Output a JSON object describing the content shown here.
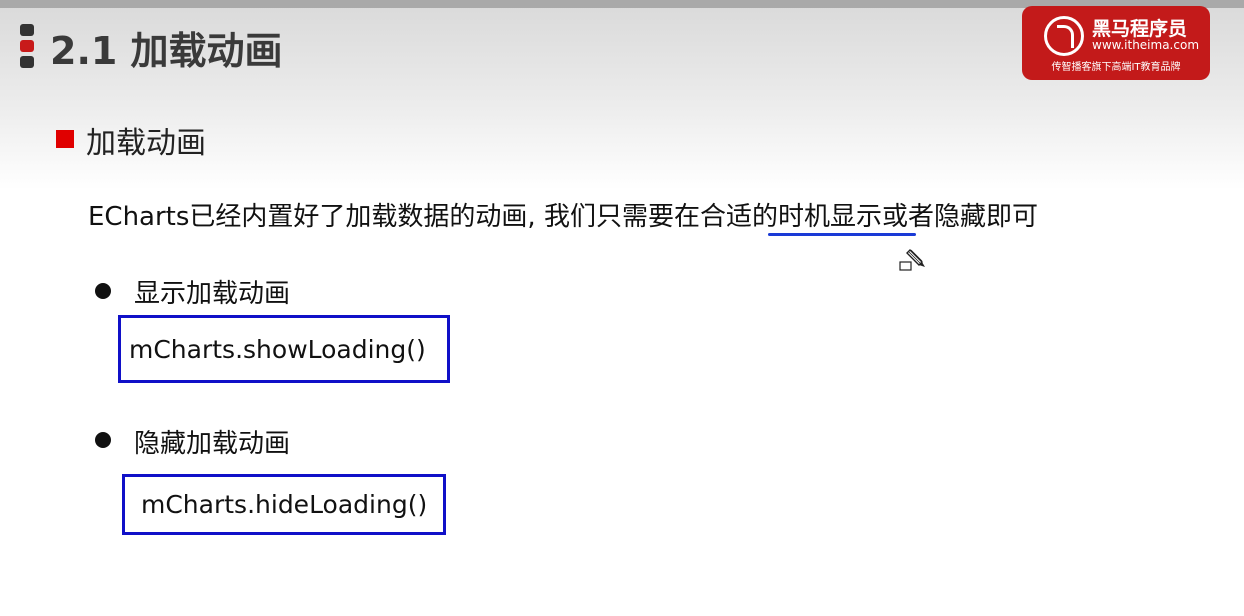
{
  "header": {
    "title": "2.1 加载动画",
    "logo": {
      "name": "黑马程序员",
      "url": "www.itheima.com",
      "slogan": "传智播客旗下高端IT教育品牌"
    }
  },
  "section": {
    "heading": "加载动画",
    "intro": "ECharts已经内置好了加载数据的动画, 我们只需要在合适的时机显示或者隐藏即可"
  },
  "items": [
    {
      "label": "显示加载动画",
      "code": "mCharts.showLoading()"
    },
    {
      "label": "隐藏加载动画",
      "code": "mCharts.hideLoading()"
    }
  ],
  "colors": {
    "accent_red": "#e00000",
    "code_border": "#1010c8",
    "underline": "#1a3ad6",
    "logo_bg": "#c31a1a"
  },
  "icons": [
    "title-marker-icon",
    "logo-mark-icon",
    "pencil-cursor-icon"
  ]
}
